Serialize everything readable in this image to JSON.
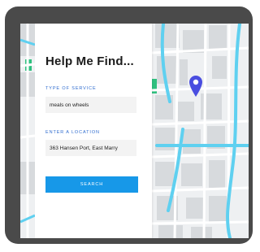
{
  "panel": {
    "title": "Help Me Find...",
    "service_type": {
      "label": "TYPE OF SERVICE",
      "value": "meals on wheels"
    },
    "location": {
      "label": "ENTER A LOCATION",
      "value": "363 Hansen Port, East Marry"
    },
    "search_label": "SEARCH"
  },
  "map": {
    "pin_icon": "map-pin-icon"
  },
  "colors": {
    "accent": "#1798e8",
    "label_blue": "#2f6ccf",
    "pin": "#4a4ee0",
    "water": "#5fd0f0",
    "frame": "#4a4a4a",
    "park": "#2fc07f"
  }
}
